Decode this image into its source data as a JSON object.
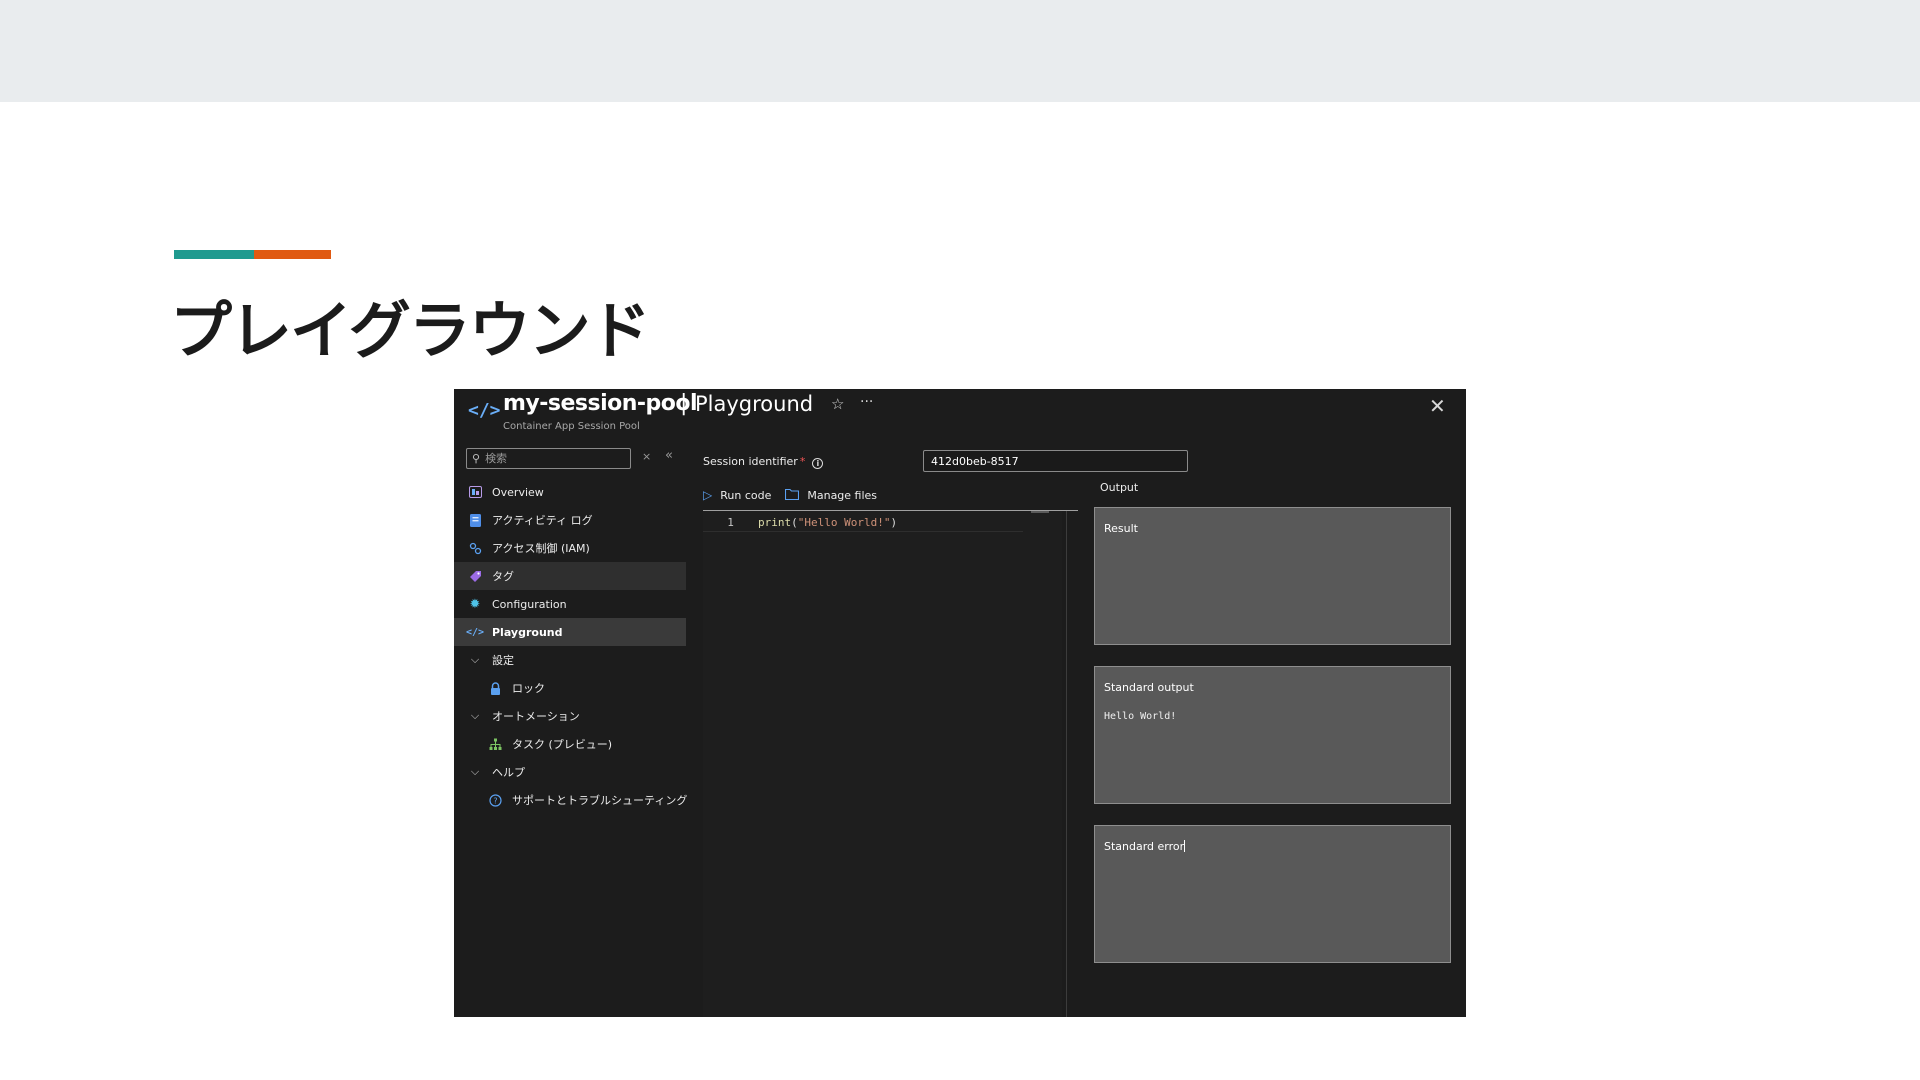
{
  "slide": {
    "title": "プレイグラウンド",
    "accent_colors": [
      "#1f9a8f",
      "#e05a12"
    ]
  },
  "header": {
    "brand_icon": "code-brackets-icon",
    "resource_name": "my-session-pool",
    "separator": "|",
    "blade_title": "Playground",
    "subtitle": "Container App Session Pool",
    "star_glyph": "☆",
    "more_glyph": "···",
    "close_glyph": "✕"
  },
  "sidebar": {
    "search_placeholder": "検索",
    "clear_glyph": "×",
    "collapse_glyph": "«",
    "items": [
      {
        "label": "Overview",
        "icon": "overview-icon"
      },
      {
        "label": "アクティビティ ログ",
        "icon": "activity-log-icon"
      },
      {
        "label": "アクセス制御 (IAM)",
        "icon": "iam-icon"
      },
      {
        "label": "タグ",
        "icon": "tag-icon"
      },
      {
        "label": "Configuration",
        "icon": "gear-icon"
      },
      {
        "label": "Playground",
        "icon": "code-brackets-icon"
      },
      {
        "label": "設定",
        "icon": "chevron-down-icon"
      },
      {
        "label": "ロック",
        "icon": "lock-icon"
      },
      {
        "label": "オートメーション",
        "icon": "chevron-down-icon"
      },
      {
        "label": "タスク (プレビュー)",
        "icon": "tasks-icon"
      },
      {
        "label": "ヘルプ",
        "icon": "chevron-down-icon"
      },
      {
        "label": "サポートとトラブルシューティング",
        "icon": "help-circle-icon"
      }
    ]
  },
  "main": {
    "session_label": "Session identifier",
    "required_marker": "*",
    "info_glyph": "i",
    "session_value": "412d0beb-8517",
    "toolbar": {
      "run_code": "Run code",
      "manage_files": "Manage files"
    },
    "editor": {
      "line_number": "1",
      "code_fn": "print",
      "code_open": "(",
      "code_string": "\"Hello World!\"",
      "code_close": ")"
    },
    "output": {
      "title": "Output",
      "result_label": "Result",
      "stdout_label": "Standard output",
      "stdout_value": "Hello World!",
      "stderr_label": "Standard error"
    }
  }
}
